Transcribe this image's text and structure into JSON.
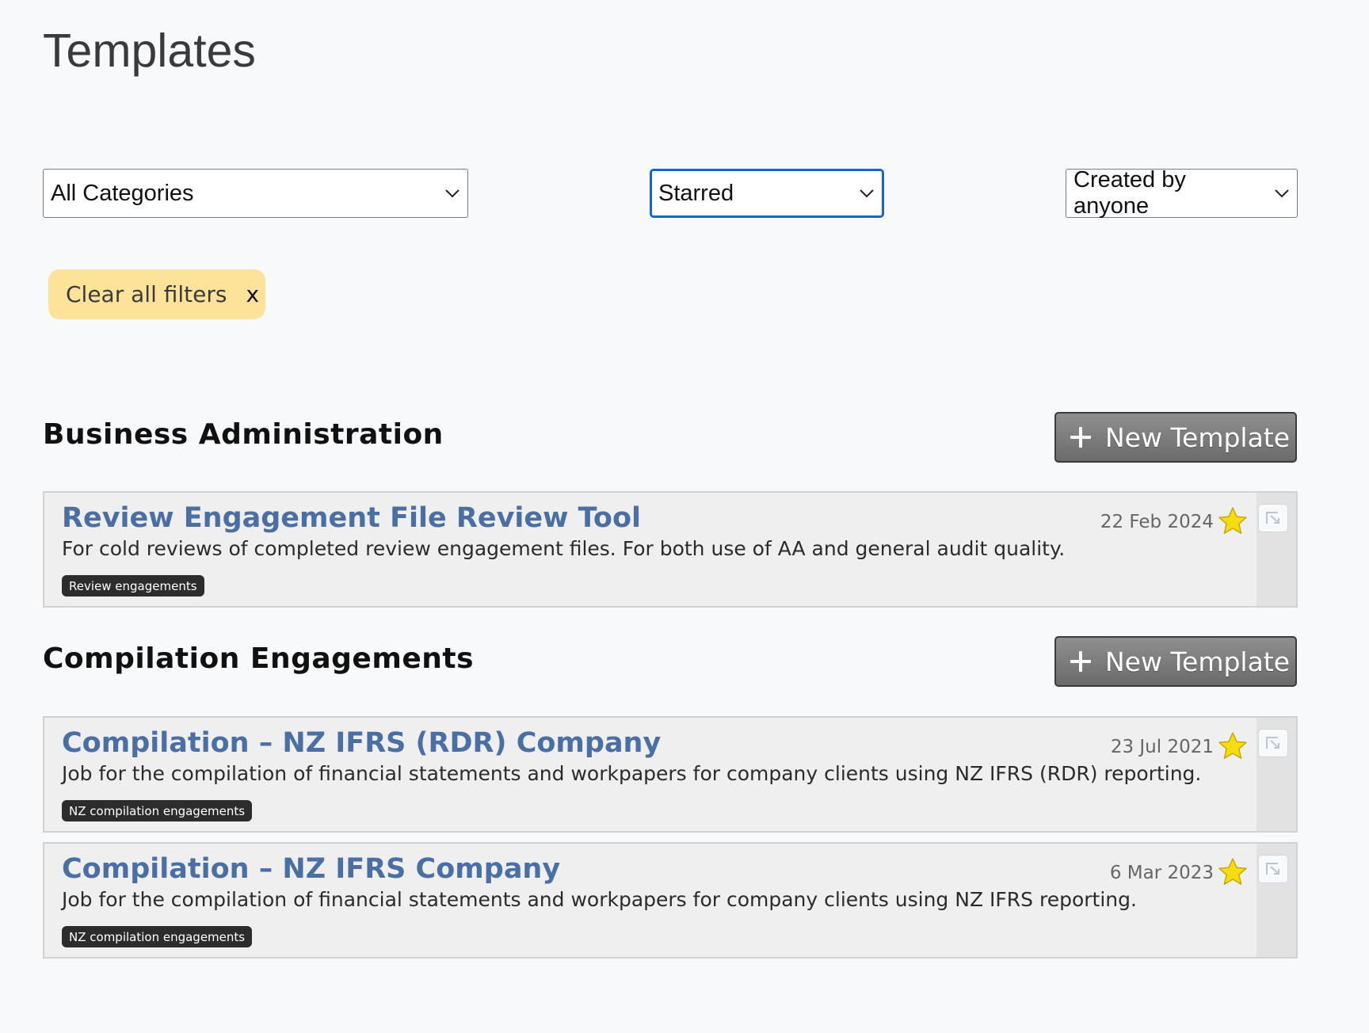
{
  "page": {
    "title": "Templates"
  },
  "filters": {
    "category": {
      "value": "All Categories"
    },
    "starred": {
      "value": "Starred"
    },
    "creator": {
      "value": "Created by anyone"
    },
    "clear_label": "Clear all filters",
    "clear_icon": "x"
  },
  "colors": {
    "accent_title": "#4a6fa5",
    "focus_border": "#1766c9",
    "clear_bg": "#fde39a",
    "star": "#f5dd12"
  },
  "sections": [
    {
      "title": "Business Administration",
      "new_button": "New Template",
      "items": [
        {
          "title": "Review Engagement File Review Tool",
          "description": "For cold reviews of completed review engagement files. For both use of AA and general audit quality.",
          "tag": "Review engagements",
          "date": "22 Feb 2024",
          "starred": true
        }
      ]
    },
    {
      "title": "Compilation Engagements",
      "new_button": "New Template",
      "items": [
        {
          "title": "Compilation – NZ IFRS (RDR) Company",
          "description": "Job for the compilation of financial statements and workpapers for company clients using NZ IFRS (RDR) reporting.",
          "tag": "NZ compilation engagements",
          "date": "23 Jul 2021",
          "starred": true
        },
        {
          "title": "Compilation – NZ IFRS Company",
          "description": "Job for the compilation of financial statements and workpapers for company clients using NZ IFRS reporting.",
          "tag": "NZ compilation engagements",
          "date": "6 Mar 2023",
          "starred": true
        }
      ]
    }
  ]
}
